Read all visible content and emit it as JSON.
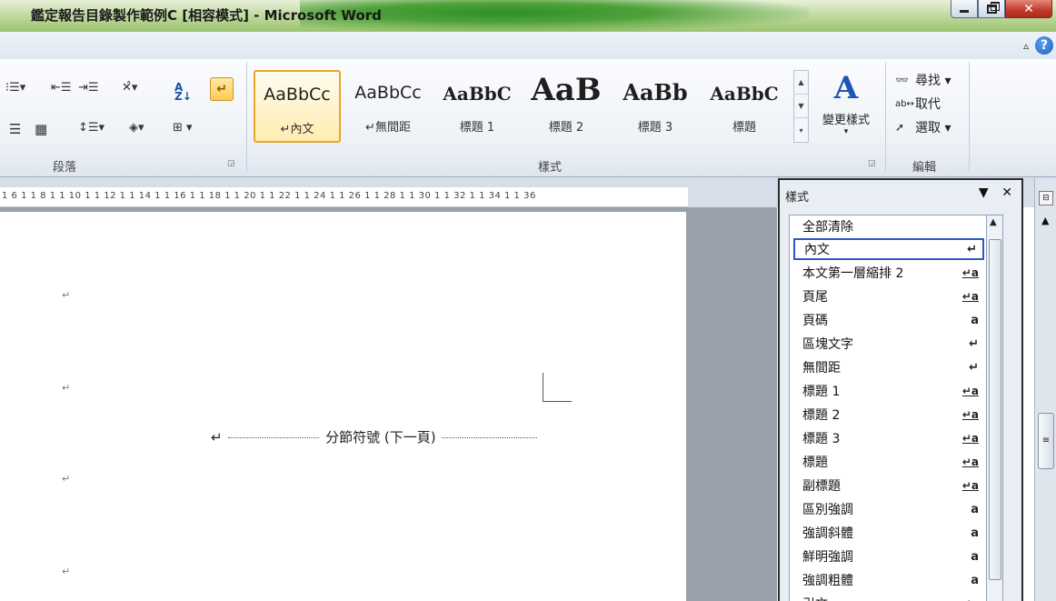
{
  "window": {
    "title": "鑑定報告目錄製作範例C [相容模式] - Microsoft Word",
    "controls": {
      "minimize": "minimize",
      "restore": "restore",
      "close": "✕"
    }
  },
  "ribbon": {
    "help": "?",
    "collapse": "▵",
    "groups": {
      "paragraph": {
        "label": "段落"
      },
      "styles": {
        "label": "樣式"
      },
      "editing": {
        "label": "編輯"
      }
    },
    "gallery": [
      {
        "sample": "AaBbCc",
        "name": "↵內文",
        "selected": true
      },
      {
        "sample": "AaBbCc",
        "name": "↵無間距",
        "selected": false
      },
      {
        "sample": "AaBbC",
        "name": "標題 1",
        "selected": false
      },
      {
        "sample": "AaB",
        "name": "標題 2",
        "selected": false
      },
      {
        "sample": "AaBb",
        "name": "標題 3",
        "selected": false
      },
      {
        "sample": "AaBbC",
        "name": "標題",
        "selected": false
      }
    ],
    "change_styles": {
      "label": "變更樣式"
    },
    "editing_items": [
      {
        "icon": "binoculars-icon",
        "label": "尋找 ▾"
      },
      {
        "icon": "replace-icon",
        "label": "取代"
      },
      {
        "icon": "select-cursor-icon",
        "label": "選取 ▾"
      }
    ]
  },
  "ruler": {
    "ticks": "1 6 1  1 8 1  1 10 1  1 12 1  1 14 1  1 16 1  1 18 1  1 20 1  1 22 1  1 24 1  1 26 1  1 28 1  1 30 1  1 32 1  1 34 1  1 36"
  },
  "document": {
    "paragraph_mark": "↵",
    "section_break": {
      "mark": "↵",
      "label": "分節符號 (下一頁)"
    }
  },
  "styles_pane": {
    "title": "樣式",
    "menu": "▼",
    "close": "✕",
    "items": [
      {
        "name": "全部清除",
        "symbol": ""
      },
      {
        "name": "內文",
        "symbol": "↵",
        "selected": true
      },
      {
        "name": "本文第一層縮排 2",
        "symbol": "↵a"
      },
      {
        "name": "頁尾",
        "symbol": "↵a"
      },
      {
        "name": "頁碼",
        "symbol": "a"
      },
      {
        "name": "區塊文字",
        "symbol": "↵"
      },
      {
        "name": "無間距",
        "symbol": "↵"
      },
      {
        "name": "標題 1",
        "symbol": "↵a"
      },
      {
        "name": "標題 2",
        "symbol": "↵a"
      },
      {
        "name": "標題 3",
        "symbol": "↵a"
      },
      {
        "name": "標題",
        "symbol": "↵a"
      },
      {
        "name": "副標題",
        "symbol": "↵a"
      },
      {
        "name": "區別強調",
        "symbol": "a"
      },
      {
        "name": "強調斜體",
        "symbol": "a"
      },
      {
        "name": "鮮明強調",
        "symbol": "a"
      },
      {
        "name": "強調粗體",
        "symbol": "a"
      },
      {
        "name": "引文",
        "symbol": "↵a"
      }
    ]
  }
}
